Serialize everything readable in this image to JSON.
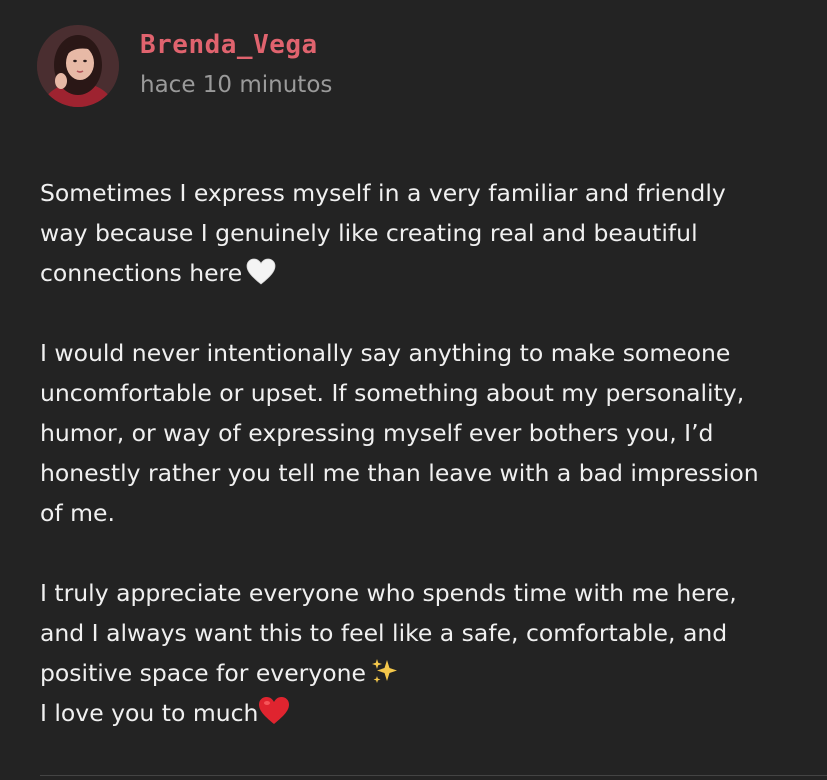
{
  "post": {
    "author": "Brenda_Vega",
    "time": "hace 10 minutos",
    "avatar_icon": "profile-photo",
    "paragraphs": [
      {
        "lines": [
          "Sometimes I express myself in a very familiar and friendly",
          "way because I genuinely like creating real and beautiful",
          "connections here"
        ],
        "end_icon": "white-heart-icon"
      },
      {
        "lines": [
          "I would never intentionally say anything to make someone",
          "uncomfortable or upset. If something about my personality,",
          "humor, or way of expressing myself ever bothers you, I’d",
          "honestly rather you tell me than leave with a bad impression",
          "of me."
        ]
      },
      {
        "lines": [
          "I truly appreciate everyone who spends time with me here,",
          "and I always want this to feel like a safe, comfortable, and",
          "positive space for everyone",
          "I love you to much"
        ],
        "icons": [
          "sparkles-icon",
          "red-heart-icon"
        ]
      }
    ]
  },
  "colors": {
    "background": "#232323",
    "username": "#e0636e",
    "timestamp": "#9a9a9a",
    "text": "#f0f0f0"
  }
}
